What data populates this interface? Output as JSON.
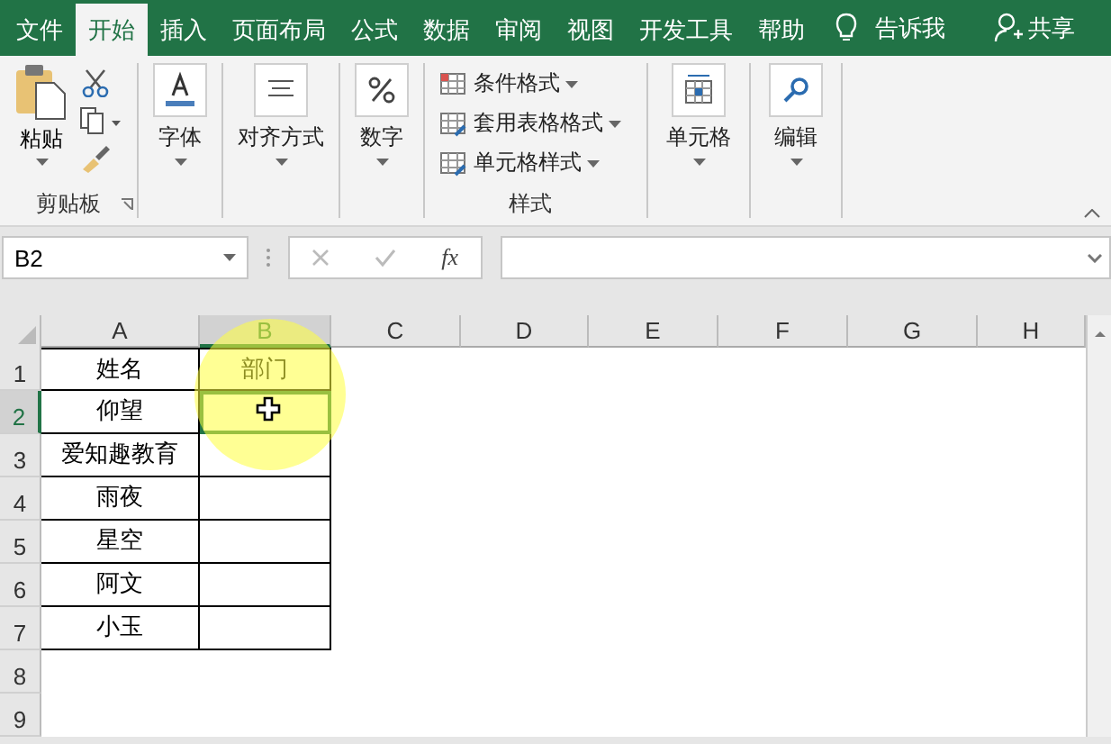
{
  "tabs": [
    {
      "label": "文件",
      "selected": false
    },
    {
      "label": "开始",
      "selected": true
    },
    {
      "label": "插入",
      "selected": false
    },
    {
      "label": "页面布局",
      "selected": false
    },
    {
      "label": "公式",
      "selected": false
    },
    {
      "label": "数据",
      "selected": false
    },
    {
      "label": "审阅",
      "selected": false
    },
    {
      "label": "视图",
      "selected": false
    },
    {
      "label": "开发工具",
      "selected": false
    },
    {
      "label": "帮助",
      "selected": false
    }
  ],
  "tell_me": "告诉我",
  "share": "共享",
  "ribbon": {
    "groups": [
      {
        "kind": "clipboard",
        "paste": "粘贴",
        "label": "剪贴板"
      },
      {
        "kind": "big",
        "label": "字体"
      },
      {
        "kind": "big",
        "label": "对齐方式"
      },
      {
        "kind": "big",
        "label": "数字"
      },
      {
        "kind": "styles",
        "items": [
          "条件格式",
          "套用表格格式",
          "单元格样式"
        ],
        "label": "样式"
      },
      {
        "kind": "big",
        "label": "单元格"
      },
      {
        "kind": "big",
        "label": "编辑"
      }
    ]
  },
  "name_box": "B2",
  "function_label": "fx",
  "sheet": {
    "columns": [
      {
        "label": "A",
        "selected": false
      },
      {
        "label": "B",
        "selected": true
      },
      {
        "label": "C",
        "selected": false
      },
      {
        "label": "D",
        "selected": false
      },
      {
        "label": "E",
        "selected": false
      },
      {
        "label": "F",
        "selected": false
      },
      {
        "label": "G",
        "selected": false
      },
      {
        "label": "H",
        "selected": false
      }
    ],
    "rows": [
      {
        "header": "1",
        "selected": false,
        "cells": [
          {
            "text": "姓名",
            "selected": false
          },
          {
            "text": "部门",
            "selected": false
          }
        ]
      },
      {
        "header": "2",
        "selected": true,
        "cells": [
          {
            "text": "仰望",
            "selected": false
          },
          {
            "selected": true
          }
        ]
      },
      {
        "header": "3",
        "selected": false,
        "cells": [
          {
            "text": "爱知趣教育",
            "selected": false
          },
          {
            "selected": false
          }
        ]
      },
      {
        "header": "4",
        "selected": false,
        "cells": [
          {
            "text": "雨夜",
            "selected": false
          },
          {
            "selected": false
          }
        ]
      },
      {
        "header": "5",
        "selected": false,
        "cells": [
          {
            "text": "星空",
            "selected": false
          },
          {
            "selected": false
          }
        ]
      },
      {
        "header": "6",
        "selected": false,
        "cells": [
          {
            "text": "阿文",
            "selected": false
          },
          {
            "selected": false
          }
        ]
      },
      {
        "header": "7",
        "selected": false,
        "cells": [
          {
            "text": "小玉",
            "selected": false
          },
          {
            "selected": false
          }
        ]
      },
      {
        "header": "8",
        "selected": false
      },
      {
        "header": "9",
        "selected": false
      }
    ]
  }
}
